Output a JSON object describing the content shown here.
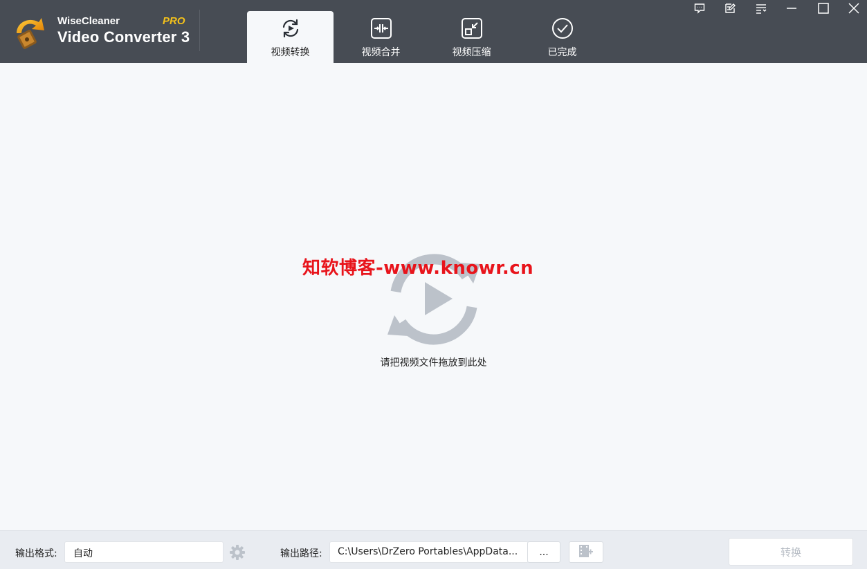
{
  "app": {
    "brand_top": "WiseCleaner",
    "brand_main": "Video Converter 3",
    "brand_pro": "PRO"
  },
  "tabs": [
    {
      "label": "视频转换",
      "icon": "refresh-icon",
      "active": true
    },
    {
      "label": "视频合并",
      "icon": "merge-icon",
      "active": false
    },
    {
      "label": "视频压缩",
      "icon": "compress-icon",
      "active": false
    },
    {
      "label": "已完成",
      "icon": "check-circle-icon",
      "active": false
    }
  ],
  "window_controls": [
    "feedback-icon",
    "edit-icon",
    "menu-icon",
    "minimize-icon",
    "maximize-icon",
    "close-icon"
  ],
  "drop_area": {
    "hint": "请把视频文件拖放到此处",
    "watermark": "知软博客-www.knowr.cn"
  },
  "bottom": {
    "format_label": "输出格式:",
    "format_value": "自动",
    "path_label": "输出路径:",
    "path_value": "C:\\Users\\DrZero Portables\\AppData...",
    "browse_label": "...",
    "convert_label": "转换"
  },
  "colors": {
    "titlebar": "#474c54",
    "background": "#f6f8fa",
    "watermark": "#e8141b",
    "pro": "#f5c21a",
    "icon_gray": "#bcc2ca"
  }
}
